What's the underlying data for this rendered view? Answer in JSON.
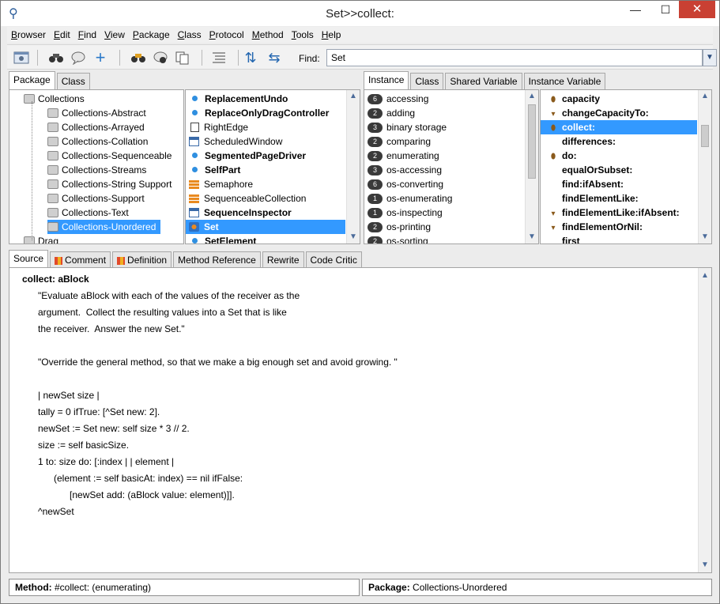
{
  "window": {
    "title": "Set>>collect:",
    "minimize": "—",
    "maximize": "☐",
    "close": "✕"
  },
  "menu": [
    "Browser",
    "Edit",
    "Find",
    "View",
    "Package",
    "Class",
    "Protocol",
    "Method",
    "Tools",
    "Help"
  ],
  "toolbar": {
    "find_label": "Find:",
    "find_value": "Set"
  },
  "package_tabs": [
    "Package",
    "Class"
  ],
  "packages": [
    {
      "name": "Collections",
      "indent": 0
    },
    {
      "name": "Collections-Abstract",
      "indent": 1
    },
    {
      "name": "Collections-Arrayed",
      "indent": 1
    },
    {
      "name": "Collections-Collation",
      "indent": 1
    },
    {
      "name": "Collections-Sequenceable",
      "indent": 1
    },
    {
      "name": "Collections-Streams",
      "indent": 1
    },
    {
      "name": "Collections-String Support",
      "indent": 1
    },
    {
      "name": "Collections-Support",
      "indent": 1
    },
    {
      "name": "Collections-Text",
      "indent": 1
    },
    {
      "name": "Collections-Unordered",
      "indent": 1,
      "selected": true
    },
    {
      "name": "Drag",
      "indent": 0
    }
  ],
  "classes": [
    {
      "name": "ReplacementUndo",
      "bold": true,
      "icon": "dot"
    },
    {
      "name": "ReplaceOnlyDragController",
      "bold": true,
      "icon": "dot"
    },
    {
      "name": "RightEdge",
      "bold": false,
      "icon": "box"
    },
    {
      "name": "ScheduledWindow",
      "bold": false,
      "icon": "window"
    },
    {
      "name": "SegmentedPageDriver",
      "bold": true,
      "icon": "dot"
    },
    {
      "name": "SelfPart",
      "bold": true,
      "icon": "dot"
    },
    {
      "name": "Semaphore",
      "bold": false,
      "icon": "grid"
    },
    {
      "name": "SequenceableCollection",
      "bold": false,
      "icon": "grid"
    },
    {
      "name": "SequenceInspector",
      "bold": true,
      "icon": "window"
    },
    {
      "name": "Set",
      "bold": true,
      "icon": "set",
      "selected": true
    },
    {
      "name": "SetElement",
      "bold": true,
      "icon": "dot"
    }
  ],
  "protocol_tabs": [
    "Instance",
    "Class",
    "Shared Variable",
    "Instance Variable"
  ],
  "protocols": [
    {
      "count": "6",
      "name": "accessing"
    },
    {
      "count": "2",
      "name": "adding"
    },
    {
      "count": "3",
      "name": "binary storage"
    },
    {
      "count": "2",
      "name": "comparing"
    },
    {
      "count": "2",
      "name": "enumerating"
    },
    {
      "count": "3",
      "name": "os-accessing"
    },
    {
      "count": "6",
      "name": "os-converting"
    },
    {
      "count": "1",
      "name": "os-enumerating"
    },
    {
      "count": "1",
      "name": "os-inspecting"
    },
    {
      "count": "2",
      "name": "os-printing"
    },
    {
      "count": "2",
      "name": "os-sorting"
    }
  ],
  "methods": [
    {
      "name": "capacity",
      "mark": "lock"
    },
    {
      "name": "changeCapacityTo:",
      "mark": "down"
    },
    {
      "name": "collect:",
      "mark": "lock",
      "selected": true
    },
    {
      "name": "differences:",
      "mark": ""
    },
    {
      "name": "do:",
      "mark": "lock"
    },
    {
      "name": "equalOrSubset:",
      "mark": ""
    },
    {
      "name": "find:ifAbsent:",
      "mark": ""
    },
    {
      "name": "findElementLike:",
      "mark": ""
    },
    {
      "name": "findElementLike:ifAbsent:",
      "mark": "down"
    },
    {
      "name": "findElementOrNil:",
      "mark": "down"
    },
    {
      "name": "first",
      "mark": ""
    }
  ],
  "code_tabs": [
    "Source",
    "Comment",
    "Definition",
    "Method Reference",
    "Rewrite",
    "Code Critic"
  ],
  "code_lines": [
    "collect: aBlock",
    "      \"Evaluate aBlock with each of the values of the receiver as the",
    "      argument.  Collect the resulting values into a Set that is like",
    "      the receiver.  Answer the new Set.\"",
    "",
    "      \"Override the general method, so that we make a big enough set and avoid growing. \"",
    "",
    "      | newSet size |",
    "      tally = 0 ifTrue: [^Set new: 2].",
    "      newSet := Set new: self size * 3 // 2.",
    "      size := self basicSize.",
    "      1 to: size do: [:index | | element |",
    "            (element := self basicAt: index) == nil ifFalse:",
    "                  [newSet add: (aBlock value: element)]].",
    "      ^newSet"
  ],
  "status": {
    "method_label": "Method:",
    "method_value": "#collect: (enumerating)",
    "package_label": "Package:",
    "package_value": "Collections-Unordered"
  }
}
